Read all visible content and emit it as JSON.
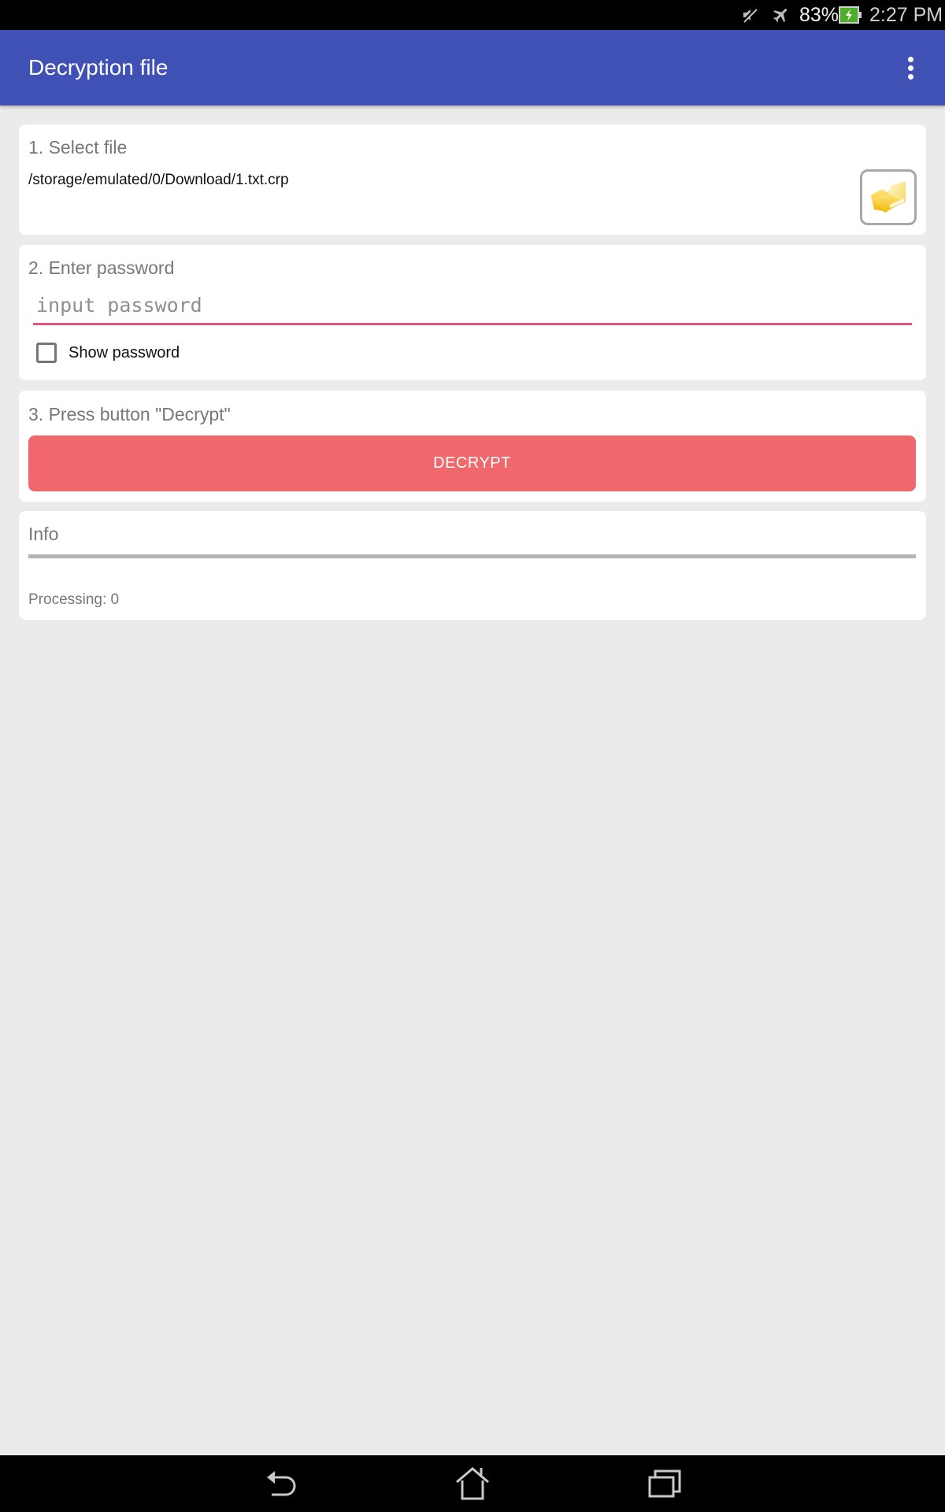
{
  "status_bar": {
    "icons": [
      "mute-icon",
      "airplane-mode-icon",
      "battery-charging-icon"
    ],
    "battery_percent": "83%",
    "time": "2:27 PM"
  },
  "app_bar": {
    "title": "Decryption file",
    "overflow_icon": "more-vert-icon"
  },
  "steps": {
    "select_file": {
      "title": "1. Select file",
      "file_path": "/storage/emulated/0/Download/1.txt.crp",
      "browse_icon": "folder-open-icon"
    },
    "password": {
      "title": "2. Enter password",
      "value": "",
      "placeholder": "input password",
      "show_password_label": "Show password",
      "show_password_checked": false
    },
    "decrypt": {
      "title": "3. Press button \"Decrypt\"",
      "button_label": "DECRYPT"
    },
    "info": {
      "title": "Info",
      "processing_text": "Processing: 0"
    }
  },
  "colors": {
    "app_bar": "#3F51B5",
    "accent": "#E5527E",
    "decrypt_button": "#F0686B",
    "background": "#EBEBEB"
  },
  "nav_bar": {
    "icons": [
      "back-icon",
      "home-icon",
      "recent-apps-icon"
    ]
  }
}
